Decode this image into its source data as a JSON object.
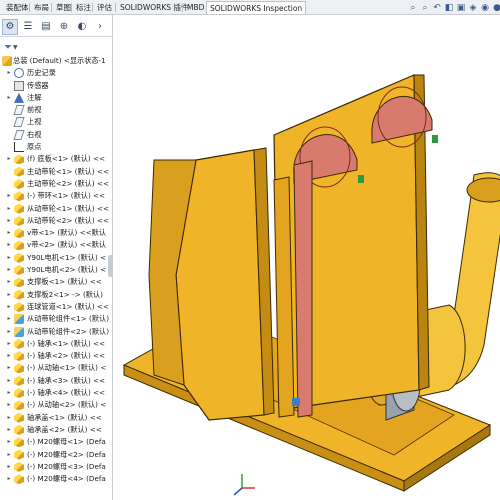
{
  "tabs": [
    "装配体",
    "布局",
    "草图",
    "标注",
    "评估",
    "SOLIDWORKS 插件",
    "MBD",
    "SOLIDWORKS Inspection"
  ],
  "active_tab": "SOLIDWORKS Inspection",
  "hud_icons": [
    "zoom-to-fit-icon",
    "zoom-area-icon",
    "previous-view-icon",
    "section-view-icon",
    "view-orientation-icon",
    "display-style-icon",
    "hide-show-icon",
    "appearance-icon",
    "scene-icon",
    "monitor-icon"
  ],
  "feature_tree": {
    "root": "总装 (Default) <显示状态-1",
    "items": [
      {
        "icon": "history",
        "expand": true,
        "label": "历史记录"
      },
      {
        "icon": "sensor",
        "expand": false,
        "label": "传感器"
      },
      {
        "icon": "annotation",
        "expand": true,
        "label": "注解"
      },
      {
        "icon": "plane",
        "expand": false,
        "label": "前视"
      },
      {
        "icon": "plane",
        "expand": false,
        "label": "上视"
      },
      {
        "icon": "plane",
        "expand": false,
        "label": "右视"
      },
      {
        "icon": "origin",
        "expand": false,
        "label": "原点"
      },
      {
        "icon": "part",
        "expand": true,
        "label": "(f) 底板<1> (默认) <<"
      },
      {
        "icon": "part",
        "expand": false,
        "label": "主动带轮<1> (默认) <<"
      },
      {
        "icon": "part",
        "expand": false,
        "label": "主动带轮<2> (默认) <<"
      },
      {
        "icon": "part",
        "expand": true,
        "label": "(-) 带环<1> (默认) <<"
      },
      {
        "icon": "part",
        "expand": true,
        "label": "从动带轮<1> (默认) <<"
      },
      {
        "icon": "part",
        "expand": true,
        "label": "从动带轮<2> (默认) <<"
      },
      {
        "icon": "part",
        "expand": true,
        "label": "v带<1> (默认) <<默认"
      },
      {
        "icon": "part",
        "expand": true,
        "label": "v带<2> (默认) <<默认"
      },
      {
        "icon": "part",
        "expand": true,
        "label": "Y90L电机<1> (默认) <"
      },
      {
        "icon": "part",
        "expand": true,
        "label": "Y90L电机<2> (默认) <"
      },
      {
        "icon": "part",
        "expand": true,
        "label": "支撑板<1> (默认) <<"
      },
      {
        "icon": "part",
        "expand": true,
        "label": "支撑板2<1> -> (默认)"
      },
      {
        "icon": "part",
        "expand": true,
        "label": "连球管道<1> (默认) <<"
      },
      {
        "icon": "subassembly",
        "expand": true,
        "label": "从动带轮组件<1> (默认)"
      },
      {
        "icon": "subassembly",
        "expand": true,
        "label": "从动带轮组件<2> (默认)"
      },
      {
        "icon": "part",
        "expand": true,
        "label": "(-) 轴承<1> (默认) <<"
      },
      {
        "icon": "part",
        "expand": true,
        "label": "(-) 轴承<2> (默认) <<"
      },
      {
        "icon": "part",
        "expand": true,
        "label": "(-) 从动轴<1> (默认) <"
      },
      {
        "icon": "part",
        "expand": true,
        "label": "(-) 轴承<3> (默认) <<"
      },
      {
        "icon": "part",
        "expand": true,
        "label": "(-) 轴承<4> (默认) <<"
      },
      {
        "icon": "part",
        "expand": true,
        "label": "(-) 从动轴<2> (默认) <"
      },
      {
        "icon": "part",
        "expand": true,
        "label": "轴承盖<1> (默认) <<"
      },
      {
        "icon": "part",
        "expand": true,
        "label": "轴承盖<2> (默认) <<"
      },
      {
        "icon": "part",
        "expand": true,
        "label": "(-) M20螺母<1> (Defa"
      },
      {
        "icon": "part",
        "expand": true,
        "label": "(-) M20螺母<2> (Defa"
      },
      {
        "icon": "part",
        "expand": true,
        "label": "(-) M20螺母<3> (Defa"
      },
      {
        "icon": "part",
        "expand": true,
        "label": "(-) M20螺母<4> (Defa"
      }
    ]
  },
  "colors": {
    "part_body": "#f0b429",
    "part_dark": "#b98410",
    "belt": "#d97a6e",
    "motor_metal": "#9aa3ad",
    "accent_blue": "#3a6fb8"
  }
}
